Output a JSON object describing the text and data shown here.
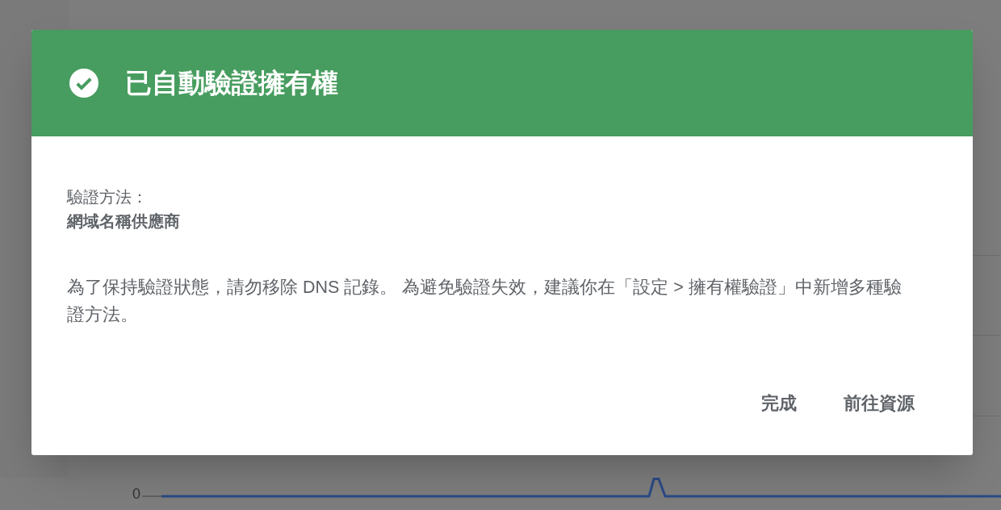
{
  "dialog": {
    "title": "已自動驗證擁有權",
    "method_label": "驗證方法：",
    "method_value": "網域名稱供應商",
    "message": "為了保持驗證狀態，請勿移除 DNS 記錄。 為避免驗證失效，建議你在「設定 > 擁有權驗證」中新增多種驗證方法。",
    "buttons": [
      {
        "label": "完成"
      },
      {
        "label": "前往資源"
      }
    ]
  },
  "chart": {
    "y_tick": "0"
  }
}
